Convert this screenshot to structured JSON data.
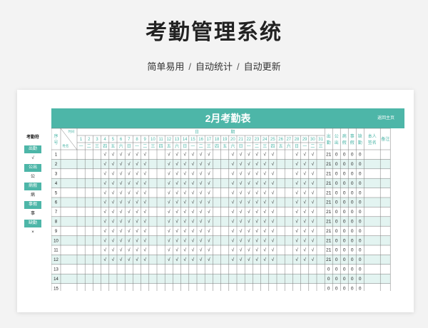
{
  "page": {
    "title": "考勤管理系统",
    "subtitle": [
      "简单易用",
      "自动统计",
      "自动更新"
    ],
    "separator": "/"
  },
  "legend": {
    "title": "考勤符",
    "items": [
      {
        "label": "出勤",
        "style": "green"
      },
      {
        "label": "√",
        "style": "white"
      },
      {
        "label": "公出",
        "style": "green"
      },
      {
        "label": "公",
        "style": "white"
      },
      {
        "label": "病假",
        "style": "green"
      },
      {
        "label": "病",
        "style": "white"
      },
      {
        "label": "事假",
        "style": "green"
      },
      {
        "label": "事",
        "style": "white"
      },
      {
        "label": "缺勤",
        "style": "green"
      },
      {
        "label": "×",
        "style": "white"
      }
    ]
  },
  "sheet": {
    "title": "2月考勤表",
    "back_link": "返回主页",
    "header": {
      "seq": [
        "序",
        "号"
      ],
      "time_label": "时间",
      "name_label": "姓名",
      "date_group": [
        "日",
        "期"
      ],
      "summary_cols": [
        [
          "出",
          "勤"
        ],
        [
          "公",
          "出"
        ],
        [
          "病",
          "假"
        ],
        [
          "事",
          "假"
        ],
        [
          "缺",
          "勤"
        ],
        [
          "本人",
          "签名"
        ],
        [
          "备注"
        ]
      ]
    },
    "days": [
      "1",
      "2",
      "3",
      "4",
      "5",
      "6",
      "7",
      "8",
      "9",
      "10",
      "11",
      "12",
      "13",
      "14",
      "15",
      "16",
      "17",
      "18",
      "19",
      "20",
      "21",
      "22",
      "23",
      "24",
      "25",
      "26",
      "27",
      "28",
      "29",
      "30",
      "31"
    ],
    "weekdays": [
      "一",
      "二",
      "三",
      "四",
      "五",
      "六",
      "日",
      "一",
      "二",
      "三",
      "四",
      "五",
      "六",
      "日",
      "一",
      "二",
      "三",
      "四",
      "五",
      "六",
      "日",
      "一",
      "二",
      "三",
      "四",
      "五",
      "六",
      "日",
      "一",
      "二",
      "三"
    ],
    "rows": [
      {
        "seq": "1",
        "marks": [
          "",
          "",
          "",
          "√",
          "√",
          "√",
          "√",
          "√",
          "√",
          "",
          "",
          "√",
          "√",
          "√",
          "√",
          "√",
          "√",
          "",
          "",
          "√",
          "√",
          "√",
          "√",
          "√",
          "√",
          "",
          "",
          "√",
          "√",
          "√",
          ""
        ],
        "totals": [
          "21",
          "0",
          "0",
          "0",
          "0",
          "",
          ""
        ]
      },
      {
        "seq": "2",
        "marks": [
          "",
          "",
          "",
          "√",
          "√",
          "√",
          "√",
          "√",
          "√",
          "",
          "",
          "√",
          "√",
          "√",
          "√",
          "√",
          "√",
          "",
          "",
          "√",
          "√",
          "√",
          "√",
          "√",
          "√",
          "",
          "",
          "√",
          "√",
          "√",
          ""
        ],
        "totals": [
          "21",
          "0",
          "0",
          "0",
          "0",
          "",
          ""
        ]
      },
      {
        "seq": "3",
        "marks": [
          "",
          "",
          "",
          "√",
          "√",
          "√",
          "√",
          "√",
          "√",
          "",
          "",
          "√",
          "√",
          "√",
          "√",
          "√",
          "√",
          "",
          "",
          "√",
          "√",
          "√",
          "√",
          "√",
          "√",
          "",
          "",
          "√",
          "√",
          "√",
          ""
        ],
        "totals": [
          "21",
          "0",
          "0",
          "0",
          "0",
          "",
          ""
        ]
      },
      {
        "seq": "4",
        "marks": [
          "",
          "",
          "",
          "√",
          "√",
          "√",
          "√",
          "√",
          "√",
          "",
          "",
          "√",
          "√",
          "√",
          "√",
          "√",
          "√",
          "",
          "",
          "√",
          "√",
          "√",
          "√",
          "√",
          "√",
          "",
          "",
          "√",
          "√",
          "√",
          ""
        ],
        "totals": [
          "21",
          "0",
          "0",
          "0",
          "0",
          "",
          ""
        ]
      },
      {
        "seq": "5",
        "marks": [
          "",
          "",
          "",
          "√",
          "√",
          "√",
          "√",
          "√",
          "√",
          "",
          "",
          "√",
          "√",
          "√",
          "√",
          "√",
          "√",
          "",
          "",
          "√",
          "√",
          "√",
          "√",
          "√",
          "√",
          "",
          "",
          "√",
          "√",
          "√",
          ""
        ],
        "totals": [
          "21",
          "0",
          "0",
          "0",
          "0",
          "",
          ""
        ]
      },
      {
        "seq": "6",
        "marks": [
          "",
          "",
          "",
          "√",
          "√",
          "√",
          "√",
          "√",
          "√",
          "",
          "",
          "√",
          "√",
          "√",
          "√",
          "√",
          "√",
          "",
          "",
          "√",
          "√",
          "√",
          "√",
          "√",
          "√",
          "",
          "",
          "√",
          "√",
          "√",
          ""
        ],
        "totals": [
          "21",
          "0",
          "0",
          "0",
          "0",
          "",
          ""
        ]
      },
      {
        "seq": "7",
        "marks": [
          "",
          "",
          "",
          "√",
          "√",
          "√",
          "√",
          "√",
          "√",
          "",
          "",
          "√",
          "√",
          "√",
          "√",
          "√",
          "√",
          "",
          "",
          "√",
          "√",
          "√",
          "√",
          "√",
          "√",
          "",
          "",
          "√",
          "√",
          "√",
          ""
        ],
        "totals": [
          "21",
          "0",
          "0",
          "0",
          "0",
          "",
          ""
        ]
      },
      {
        "seq": "8",
        "marks": [
          "",
          "",
          "",
          "√",
          "√",
          "√",
          "√",
          "√",
          "√",
          "",
          "",
          "√",
          "√",
          "√",
          "√",
          "√",
          "√",
          "",
          "",
          "√",
          "√",
          "√",
          "√",
          "√",
          "√",
          "",
          "",
          "√",
          "√",
          "√",
          ""
        ],
        "totals": [
          "21",
          "0",
          "0",
          "0",
          "0",
          "",
          ""
        ]
      },
      {
        "seq": "9",
        "marks": [
          "",
          "",
          "",
          "√",
          "√",
          "√",
          "√",
          "√",
          "√",
          "",
          "",
          "√",
          "√",
          "√",
          "√",
          "√",
          "√",
          "",
          "",
          "√",
          "√",
          "√",
          "√",
          "√",
          "√",
          "",
          "",
          "√",
          "√",
          "√",
          ""
        ],
        "totals": [
          "21",
          "0",
          "0",
          "0",
          "0",
          "",
          ""
        ]
      },
      {
        "seq": "10",
        "marks": [
          "",
          "",
          "",
          "√",
          "√",
          "√",
          "√",
          "√",
          "√",
          "",
          "",
          "√",
          "√",
          "√",
          "√",
          "√",
          "√",
          "",
          "",
          "√",
          "√",
          "√",
          "√",
          "√",
          "√",
          "",
          "",
          "√",
          "√",
          "√",
          ""
        ],
        "totals": [
          "21",
          "0",
          "0",
          "0",
          "0",
          "",
          ""
        ]
      },
      {
        "seq": "11",
        "marks": [
          "",
          "",
          "",
          "√",
          "√",
          "√",
          "√",
          "√",
          "√",
          "",
          "",
          "√",
          "√",
          "√",
          "√",
          "√",
          "√",
          "",
          "",
          "√",
          "√",
          "√",
          "√",
          "√",
          "√",
          "",
          "",
          "√",
          "√",
          "√",
          ""
        ],
        "totals": [
          "21",
          "0",
          "0",
          "0",
          "0",
          "",
          ""
        ]
      },
      {
        "seq": "12",
        "marks": [
          "",
          "",
          "",
          "√",
          "√",
          "√",
          "√",
          "√",
          "√",
          "",
          "",
          "√",
          "√",
          "√",
          "√",
          "√",
          "√",
          "",
          "",
          "√",
          "√",
          "√",
          "√",
          "√",
          "√",
          "",
          "",
          "√",
          "√",
          "√",
          ""
        ],
        "totals": [
          "21",
          "0",
          "0",
          "0",
          "0",
          "",
          ""
        ]
      },
      {
        "seq": "13",
        "marks": [],
        "totals": [
          "0",
          "0",
          "0",
          "0",
          "0",
          "",
          ""
        ]
      },
      {
        "seq": "14",
        "marks": [],
        "totals": [
          "0",
          "0",
          "0",
          "0",
          "0",
          "",
          ""
        ]
      },
      {
        "seq": "15",
        "marks": [],
        "totals": [
          "0",
          "0",
          "0",
          "0",
          "0",
          "",
          ""
        ]
      }
    ]
  },
  "colors": {
    "accent": "#4db6a8",
    "row_stripe": "#e3f4f1",
    "grid": "#7a7a7a"
  }
}
